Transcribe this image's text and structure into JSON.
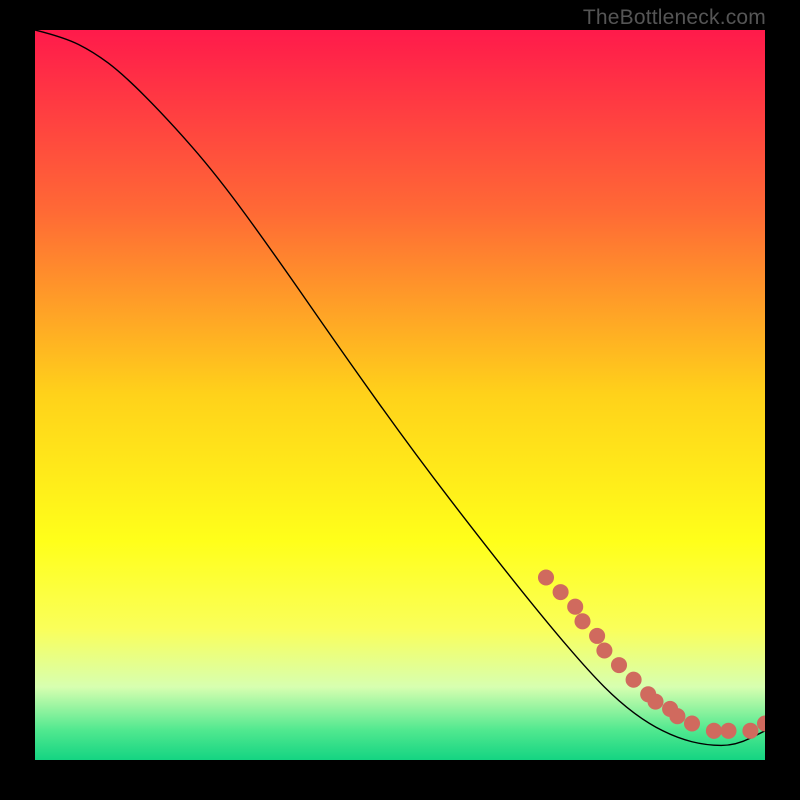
{
  "watermark": "TheBottleneck.com",
  "chart_data": {
    "type": "line",
    "title": "",
    "xlabel": "",
    "ylabel": "",
    "xlim": [
      0,
      100
    ],
    "ylim": [
      0,
      100
    ],
    "background_gradient": {
      "stops": [
        {
          "offset": 0.0,
          "color": "#ff1a4b"
        },
        {
          "offset": 0.25,
          "color": "#ff6a35"
        },
        {
          "offset": 0.5,
          "color": "#ffd21a"
        },
        {
          "offset": 0.7,
          "color": "#ffff1a"
        },
        {
          "offset": 0.82,
          "color": "#faff5a"
        },
        {
          "offset": 0.9,
          "color": "#d7ffb0"
        },
        {
          "offset": 0.96,
          "color": "#4fe88f"
        },
        {
          "offset": 1.0,
          "color": "#14d482"
        }
      ]
    },
    "series": [
      {
        "name": "curve",
        "type": "line",
        "x": [
          0,
          4,
          8,
          12,
          18,
          25,
          33,
          42,
          52,
          62,
          70,
          76,
          80,
          84,
          88,
          92,
          96,
          100
        ],
        "y": [
          100,
          99,
          97,
          94,
          88,
          80,
          69,
          56,
          42,
          29,
          19,
          12,
          8,
          5,
          3,
          2,
          2,
          4
        ]
      },
      {
        "name": "dots",
        "type": "scatter",
        "x": [
          70,
          72,
          74,
          75,
          77,
          78,
          80,
          82,
          84,
          85,
          87,
          88,
          90,
          93,
          95,
          98,
          100
        ],
        "y": [
          25,
          23,
          21,
          19,
          17,
          15,
          13,
          11,
          9,
          8,
          7,
          6,
          5,
          4,
          4,
          4,
          5
        ],
        "color": "#d06a5e",
        "size": 8
      }
    ]
  }
}
